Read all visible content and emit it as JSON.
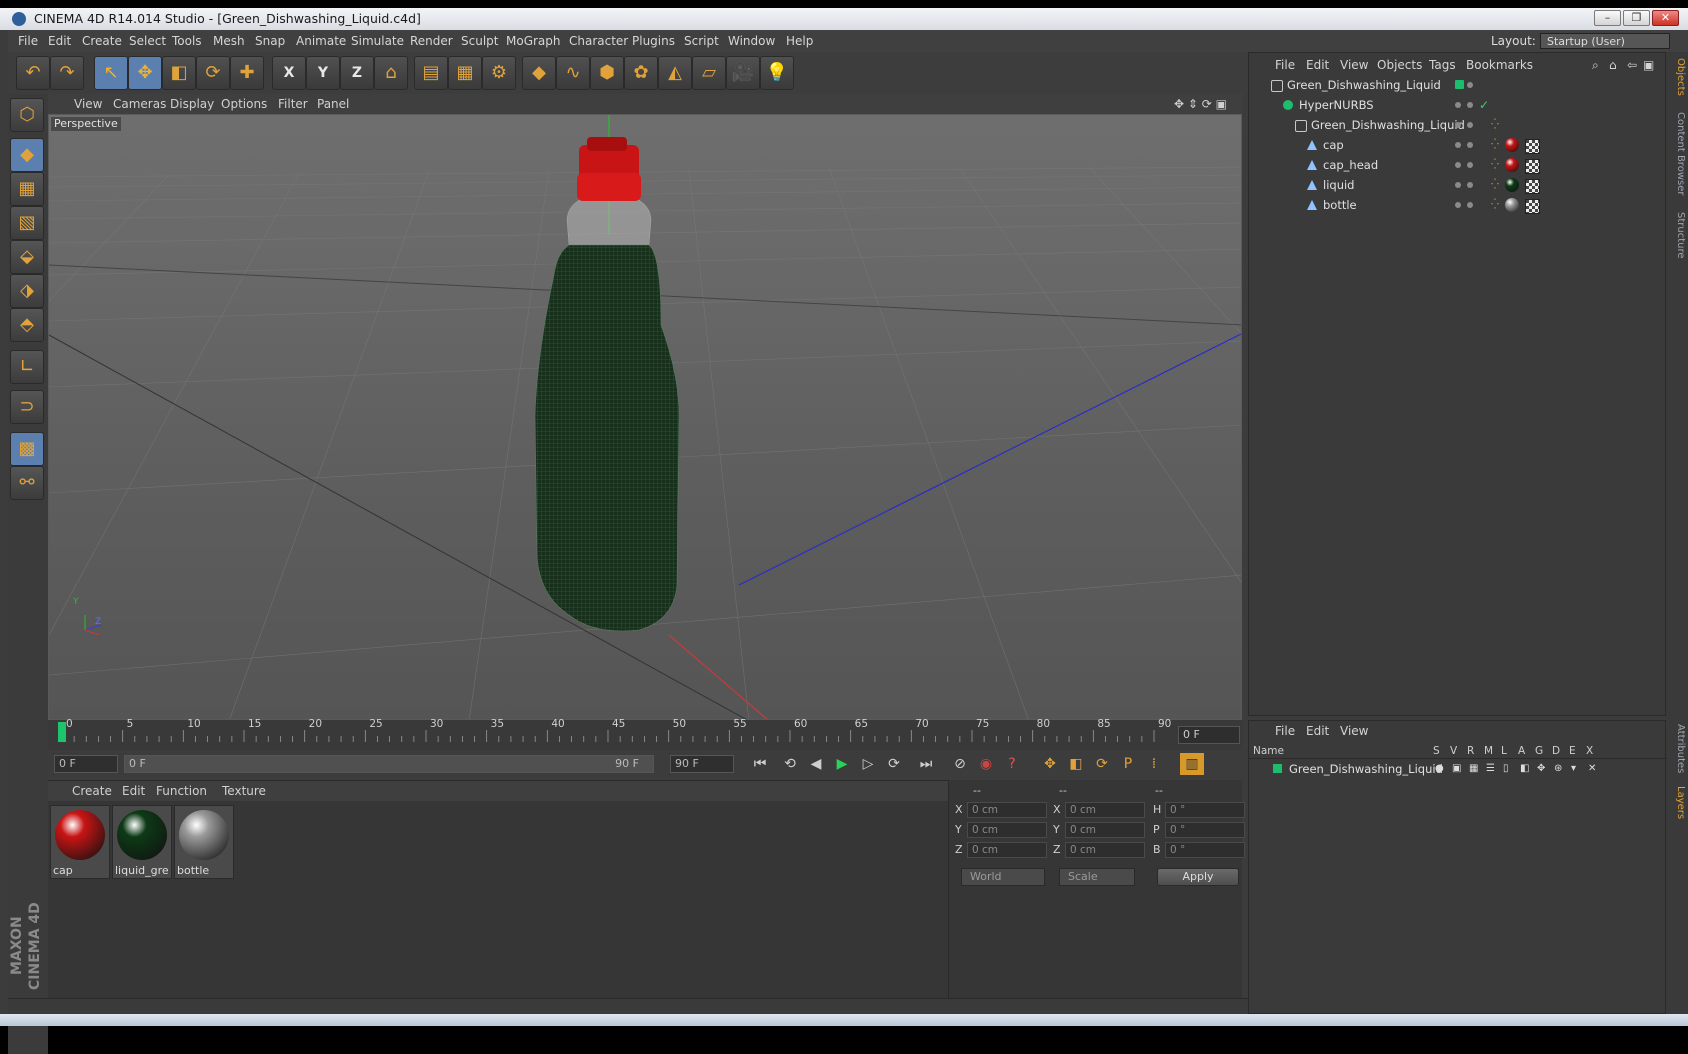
{
  "window": {
    "title": "CINEMA 4D R14.014 Studio - [Green_Dishwashing_Liquid.c4d]",
    "controls": [
      "–",
      "❐",
      "✕"
    ]
  },
  "menubar": {
    "items": [
      "File",
      "Edit",
      "Create",
      "Select",
      "Tools",
      "Mesh",
      "Snap",
      "Animate",
      "Simulate",
      "Render",
      "Sculpt",
      "MoGraph",
      "Character",
      "Plugins",
      "Script",
      "Window",
      "Help"
    ],
    "layout_label": "Layout:",
    "layout_value": "Startup (User)"
  },
  "toolbar": {
    "buttons": [
      {
        "icon": "undo-icon",
        "glyph": "↶"
      },
      {
        "icon": "redo-icon",
        "glyph": "↷"
      },
      {
        "icon": "live-selection-icon",
        "glyph": "↖"
      },
      {
        "icon": "move-icon",
        "glyph": "✥"
      },
      {
        "icon": "scale-icon",
        "glyph": "◧"
      },
      {
        "icon": "rotate-icon",
        "glyph": "⟳"
      },
      {
        "icon": "add-object-icon",
        "glyph": "✚"
      },
      {
        "icon": "x-axis-icon",
        "glyph": "X"
      },
      {
        "icon": "y-axis-icon",
        "glyph": "Y"
      },
      {
        "icon": "z-axis-icon",
        "glyph": "Z"
      },
      {
        "icon": "coordinate-system-icon",
        "glyph": "⌂"
      },
      {
        "icon": "render-view-icon",
        "glyph": "▤"
      },
      {
        "icon": "render-picture-viewer-icon",
        "glyph": "▦"
      },
      {
        "icon": "render-settings-icon",
        "glyph": "⚙"
      },
      {
        "icon": "cube-icon",
        "glyph": "◆"
      },
      {
        "icon": "spline-icon",
        "glyph": "∿"
      },
      {
        "icon": "nurbs-icon",
        "glyph": "⬢"
      },
      {
        "icon": "array-icon",
        "glyph": "✿"
      },
      {
        "icon": "deformer-icon",
        "glyph": "◭"
      },
      {
        "icon": "floor-icon",
        "glyph": "▱"
      },
      {
        "icon": "camera-icon",
        "glyph": "🎥"
      },
      {
        "icon": "light-icon",
        "glyph": "💡"
      }
    ]
  },
  "left_tools": [
    {
      "icon": "make-editable-icon",
      "glyph": "⬡"
    },
    {
      "icon": "model-mode-icon",
      "glyph": "◆"
    },
    {
      "icon": "texture-mode-icon",
      "glyph": "▦"
    },
    {
      "icon": "workplane-icon",
      "glyph": "▧"
    },
    {
      "icon": "points-mode-icon",
      "glyph": "⬙"
    },
    {
      "icon": "edges-mode-icon",
      "glyph": "⬗"
    },
    {
      "icon": "polygons-mode-icon",
      "glyph": "⬘"
    },
    {
      "icon": "axis-mode-icon",
      "glyph": "∟"
    },
    {
      "icon": "magnet-icon",
      "glyph": "⊃"
    },
    {
      "icon": "lock-workplane-icon",
      "glyph": "▩"
    },
    {
      "icon": "snap-icon",
      "glyph": "⚯"
    }
  ],
  "brand": "MAXON CINEMA 4D",
  "viewport": {
    "menu": [
      "View",
      "Cameras",
      "Display",
      "Options",
      "Filter",
      "Panel"
    ],
    "label": "Perspective",
    "axis_labels": {
      "y": "Y",
      "z": "Z"
    }
  },
  "timeline": {
    "ticks": [
      "0",
      "5",
      "10",
      "15",
      "20",
      "25",
      "30",
      "35",
      "40",
      "45",
      "50",
      "55",
      "60",
      "65",
      "70",
      "75",
      "80",
      "85",
      "90"
    ],
    "current_frame": "0 F"
  },
  "transport": {
    "start_field": "0 F",
    "range_start": "0 F",
    "range_end": "90 F",
    "end_field": "90 F",
    "buttons": [
      {
        "icon": "go-to-start-icon",
        "glyph": "⏮"
      },
      {
        "icon": "previous-key-icon",
        "glyph": "⟲"
      },
      {
        "icon": "previous-frame-icon",
        "glyph": "◀"
      },
      {
        "icon": "play-icon",
        "glyph": "▶"
      },
      {
        "icon": "next-frame-icon",
        "glyph": "▷"
      },
      {
        "icon": "next-key-icon",
        "glyph": "⟳"
      },
      {
        "icon": "go-to-end-icon",
        "glyph": "⏭"
      },
      {
        "icon": "record-keys-icon",
        "glyph": "⊘"
      },
      {
        "icon": "autokey-icon",
        "glyph": "◉"
      },
      {
        "icon": "keyframe-selection-icon",
        "glyph": "?"
      },
      {
        "icon": "key-position-icon",
        "glyph": "✥"
      },
      {
        "icon": "key-scale-icon",
        "glyph": "◧"
      },
      {
        "icon": "key-rotation-icon",
        "glyph": "⟳"
      },
      {
        "icon": "key-parameter-icon",
        "glyph": "P"
      },
      {
        "icon": "key-pla-icon",
        "glyph": "⁞"
      },
      {
        "icon": "timeline-window-icon",
        "glyph": "▥"
      }
    ]
  },
  "material_manager": {
    "menu": [
      "Create",
      "Edit",
      "Function",
      "Texture"
    ],
    "materials": [
      {
        "name": "cap",
        "color": "#c81414"
      },
      {
        "name": "liquid_gree",
        "color": "#0d3a16"
      },
      {
        "name": "bottle",
        "color": "#9a9a9a"
      }
    ]
  },
  "coordinates": {
    "headers": [
      "--",
      "--",
      "--"
    ],
    "rows": [
      {
        "a": "X",
        "av": "0 cm",
        "b": "X",
        "bv": "0 cm",
        "c": "H",
        "cv": "0 °"
      },
      {
        "a": "Y",
        "av": "0 cm",
        "b": "Y",
        "bv": "0 cm",
        "c": "P",
        "cv": "0 °"
      },
      {
        "a": "Z",
        "av": "0 cm",
        "b": "Z",
        "bv": "0 cm",
        "c": "B",
        "cv": "0 °"
      }
    ],
    "mode_select": "World",
    "scale_select": "Scale",
    "apply": "Apply"
  },
  "object_manager": {
    "menu": [
      "File",
      "Edit",
      "View",
      "Objects",
      "Tags",
      "Bookmarks"
    ],
    "rows": [
      {
        "name": "Green_Dishwashing_Liquid",
        "depth": 0,
        "icon": "null-icon"
      },
      {
        "name": "HyperNURBS",
        "depth": 1,
        "icon": "hypernurbs-icon"
      },
      {
        "name": "Green_Dishwashing_Liquid",
        "depth": 2,
        "icon": "null-icon"
      },
      {
        "name": "cap",
        "depth": 3,
        "icon": "polygon-object-icon",
        "material": "#c81414"
      },
      {
        "name": "cap_head",
        "depth": 3,
        "icon": "polygon-object-icon",
        "material": "#c81414"
      },
      {
        "name": "liquid",
        "depth": 3,
        "icon": "polygon-object-icon",
        "material": "#0d3a16"
      },
      {
        "name": "bottle",
        "depth": 3,
        "icon": "polygon-object-icon",
        "material": "#9a9a9a"
      }
    ]
  },
  "side_tabs": [
    "Objects",
    "Content Browser",
    "Structure",
    "Attributes",
    "Layers"
  ],
  "layer_manager": {
    "menu": [
      "File",
      "Edit",
      "View"
    ],
    "header": {
      "name": "Name",
      "cols": [
        "S",
        "V",
        "R",
        "M",
        "L",
        "A",
        "G",
        "D",
        "E",
        "X"
      ]
    },
    "rows": [
      {
        "name": "Green_Dishwashing_Liquid",
        "color": "#1dbd6e"
      }
    ]
  },
  "colors": {
    "accent": "#5b7fae",
    "icon_orange": "#e0a23a",
    "layer_green": "#1dbd6e"
  }
}
